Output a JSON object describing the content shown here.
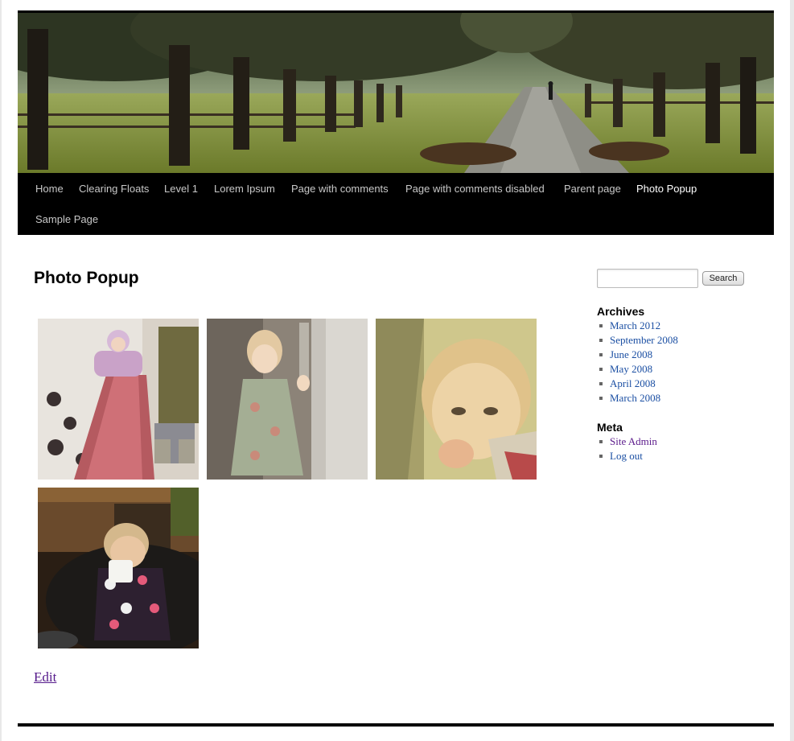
{
  "nav": {
    "items": [
      {
        "label": "Home"
      },
      {
        "label": "Clearing Floats"
      },
      {
        "label": "Level 1"
      },
      {
        "label": "Lorem Ipsum"
      },
      {
        "label": "Page with comments"
      },
      {
        "label": "Page with comments disabled"
      },
      {
        "label": "Parent page"
      },
      {
        "label": "Photo Popup"
      },
      {
        "label": "Sample Page"
      }
    ],
    "current": "Photo Popup"
  },
  "entry": {
    "title": "Photo Popup",
    "edit_label": "Edit"
  },
  "gallery": {
    "images": [
      "photo-slide",
      "photo-door",
      "photo-closeup",
      "photo-cup"
    ]
  },
  "sidebar": {
    "search": {
      "button_label": "Search",
      "value": "",
      "placeholder": ""
    },
    "archives": {
      "title": "Archives",
      "items": [
        "March 2012",
        "September 2008",
        "June 2008",
        "May 2008",
        "April 2008",
        "March 2008"
      ]
    },
    "meta": {
      "title": "Meta",
      "items": [
        "Site Admin",
        "Log out"
      ]
    }
  },
  "colors": {
    "link": "#1b4fa3",
    "visited_link": "#5b1a8b",
    "nav_background": "#000000",
    "nav_text": "#c8c8c8"
  }
}
